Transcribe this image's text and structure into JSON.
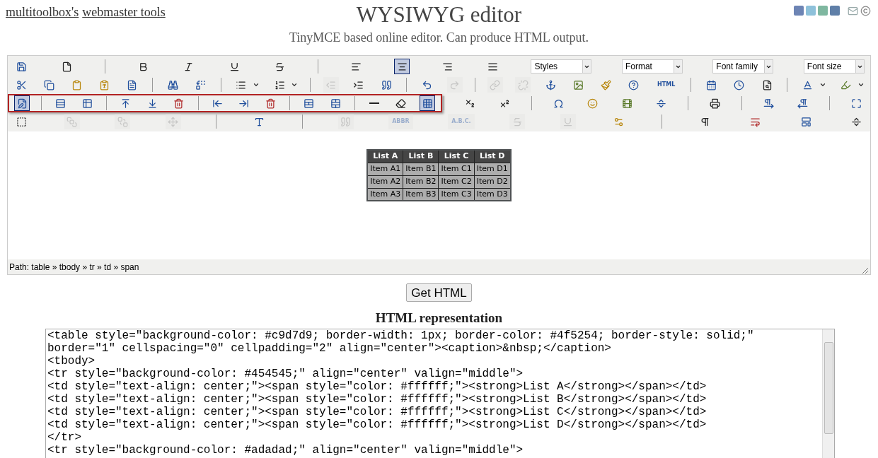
{
  "header": {
    "links": [
      "multitoolbox's",
      "webmaster tools"
    ],
    "title": "WYSIWYG editor",
    "subtitle": "TinyMCE based online editor. Can produce HTML output."
  },
  "toolbar": [
    {
      "groups": [
        {
          "highlighted": false,
          "items": [
            {
              "kind": "button",
              "selected": false,
              "disabled": false
            },
            {
              "kind": "button",
              "selected": false,
              "disabled": false
            },
            {
              "kind": "separator"
            },
            {
              "kind": "button",
              "selected": false,
              "disabled": false
            },
            {
              "kind": "button",
              "selected": false,
              "disabled": false
            },
            {
              "kind": "button",
              "selected": false,
              "disabled": false
            },
            {
              "kind": "button",
              "selected": false,
              "disabled": false
            },
            {
              "kind": "separator"
            },
            {
              "kind": "button",
              "selected": false,
              "disabled": false
            },
            {
              "kind": "button",
              "selected": true,
              "disabled": false
            },
            {
              "kind": "button",
              "selected": false,
              "disabled": false
            },
            {
              "kind": "button",
              "selected": false,
              "disabled": false
            },
            {
              "kind": "select",
              "value": "Styles"
            },
            {
              "kind": "select",
              "value": "Format"
            },
            {
              "kind": "select",
              "value": "Font family"
            },
            {
              "kind": "select",
              "value": "Font size"
            }
          ]
        }
      ]
    },
    {
      "groups": [
        {
          "highlighted": false,
          "items": [
            {
              "kind": "button",
              "selected": false,
              "disabled": false
            },
            {
              "kind": "button",
              "selected": false,
              "disabled": false
            },
            {
              "kind": "button",
              "selected": false,
              "disabled": false
            },
            {
              "kind": "button",
              "selected": false,
              "disabled": false
            },
            {
              "kind": "button",
              "selected": false,
              "disabled": false
            },
            {
              "kind": "separator"
            },
            {
              "kind": "button",
              "selected": false,
              "disabled": false
            },
            {
              "kind": "button",
              "selected": false,
              "disabled": false
            },
            {
              "kind": "separator"
            },
            {
              "kind": "button",
              "selected": false,
              "disabled": false
            },
            {
              "kind": "arrow"
            },
            {
              "kind": "button",
              "selected": false,
              "disabled": false
            },
            {
              "kind": "arrow"
            },
            {
              "kind": "separator"
            },
            {
              "kind": "button",
              "selected": false,
              "disabled": true
            },
            {
              "kind": "button",
              "selected": false,
              "disabled": false
            },
            {
              "kind": "button",
              "selected": false,
              "disabled": false
            },
            {
              "kind": "separator"
            },
            {
              "kind": "button",
              "selected": false,
              "disabled": false
            },
            {
              "kind": "button",
              "selected": false,
              "disabled": true
            },
            {
              "kind": "separator"
            },
            {
              "kind": "button",
              "selected": false,
              "disabled": true
            },
            {
              "kind": "button",
              "selected": false,
              "disabled": true
            },
            {
              "kind": "button",
              "selected": false,
              "disabled": false
            },
            {
              "kind": "button",
              "selected": false,
              "disabled": false
            },
            {
              "kind": "button",
              "selected": false,
              "disabled": false
            },
            {
              "kind": "button",
              "selected": false,
              "disabled": false
            },
            {
              "kind": "text",
              "label": "HTML",
              "selected": false,
              "disabled": false
            },
            {
              "kind": "separator"
            },
            {
              "kind": "button",
              "selected": false,
              "disabled": false
            },
            {
              "kind": "button",
              "selected": false,
              "disabled": false
            },
            {
              "kind": "button",
              "selected": false,
              "disabled": false
            },
            {
              "kind": "separator"
            },
            {
              "kind": "button",
              "selected": false,
              "disabled": false
            },
            {
              "kind": "arrow"
            },
            {
              "kind": "button",
              "selected": false,
              "disabled": false
            },
            {
              "kind": "arrow"
            }
          ]
        }
      ]
    },
    {
      "groups": [
        {
          "highlighted": true,
          "items": [
            {
              "kind": "button",
              "selected": true,
              "disabled": false
            },
            {
              "kind": "separator"
            },
            {
              "kind": "button",
              "selected": false,
              "disabled": false
            },
            {
              "kind": "button",
              "selected": false,
              "disabled": false
            },
            {
              "kind": "separator"
            },
            {
              "kind": "button",
              "selected": false,
              "disabled": false
            },
            {
              "kind": "button",
              "selected": false,
              "disabled": false
            },
            {
              "kind": "button",
              "selected": false,
              "disabled": false
            },
            {
              "kind": "separator"
            },
            {
              "kind": "button",
              "selected": false,
              "disabled": false
            },
            {
              "kind": "button",
              "selected": false,
              "disabled": false
            },
            {
              "kind": "button",
              "selected": false,
              "disabled": false
            },
            {
              "kind": "separator"
            },
            {
              "kind": "button",
              "selected": false,
              "disabled": false
            },
            {
              "kind": "button",
              "selected": false,
              "disabled": false
            },
            {
              "kind": "separator"
            },
            {
              "kind": "button",
              "selected": false,
              "disabled": false
            },
            {
              "kind": "button",
              "selected": false,
              "disabled": false
            },
            {
              "kind": "button",
              "selected": true,
              "disabled": false
            }
          ]
        },
        {
          "highlighted": false,
          "items": [
            {
              "kind": "separator"
            },
            {
              "kind": "button",
              "selected": false,
              "disabled": false
            },
            {
              "kind": "button",
              "selected": false,
              "disabled": false
            },
            {
              "kind": "separator"
            },
            {
              "kind": "button",
              "selected": false,
              "disabled": false
            },
            {
              "kind": "button",
              "selected": false,
              "disabled": false
            },
            {
              "kind": "button",
              "selected": false,
              "disabled": false
            },
            {
              "kind": "button",
              "selected": false,
              "disabled": false
            },
            {
              "kind": "separator"
            },
            {
              "kind": "button",
              "selected": false,
              "disabled": false
            },
            {
              "kind": "separator"
            },
            {
              "kind": "button",
              "selected": false,
              "disabled": false
            },
            {
              "kind": "button",
              "selected": false,
              "disabled": false
            },
            {
              "kind": "separator"
            },
            {
              "kind": "button",
              "selected": false,
              "disabled": false
            }
          ]
        }
      ]
    },
    {
      "groups": [
        {
          "highlighted": false,
          "items": [
            {
              "kind": "button",
              "selected": false,
              "disabled": false
            },
            {
              "kind": "button",
              "selected": false,
              "disabled": true
            },
            {
              "kind": "button",
              "selected": false,
              "disabled": true
            },
            {
              "kind": "button",
              "selected": false,
              "disabled": true
            },
            {
              "kind": "separator"
            },
            {
              "kind": "button",
              "selected": false,
              "disabled": false
            },
            {
              "kind": "separator"
            },
            {
              "kind": "button",
              "selected": false,
              "disabled": true
            },
            {
              "kind": "text",
              "label": "ABBR",
              "selected": false,
              "disabled": true
            },
            {
              "kind": "text",
              "label": "A.B.C.",
              "selected": false,
              "disabled": true
            },
            {
              "kind": "button",
              "selected": false,
              "disabled": true
            },
            {
              "kind": "button",
              "selected": false,
              "disabled": true
            },
            {
              "kind": "button",
              "selected": false,
              "disabled": false
            },
            {
              "kind": "separator"
            },
            {
              "kind": "button",
              "selected": false,
              "disabled": false
            },
            {
              "kind": "button",
              "selected": false,
              "disabled": false
            },
            {
              "kind": "button",
              "selected": false,
              "disabled": false
            },
            {
              "kind": "button",
              "selected": false,
              "disabled": false
            }
          ]
        }
      ]
    }
  ],
  "editor": {
    "table": {
      "columns": [
        "List A",
        "List B",
        "List C",
        "List D"
      ],
      "rows": [
        [
          "Item A1",
          "Item B1",
          "Item C1",
          "Item D1"
        ],
        [
          "Item A2",
          "Item B2",
          "Item C2",
          "Item D2"
        ],
        [
          "Item A3",
          "Item B3",
          "Item C3",
          "Item D3"
        ]
      ]
    },
    "path": "Path: table » tbody » tr » td » span"
  },
  "get_html_button": "Get HTML",
  "html_heading": "HTML representation",
  "html_output": "<table style=\"background-color: #c9d7d9; border-width: 1px; border-color: #4f5254; border-style: solid;\"\nborder=\"1\" cellspacing=\"0\" cellpadding=\"2\" align=\"center\"><caption>&nbsp;</caption>\n<tbody>\n<tr style=\"background-color: #454545;\" align=\"center\" valign=\"middle\">\n<td style=\"text-align: center;\"><span style=\"color: #ffffff;\"><strong>List A</strong></span></td>\n<td style=\"text-align: center;\"><span style=\"color: #ffffff;\"><strong>List B</strong></span></td>\n<td style=\"text-align: center;\"><span style=\"color: #ffffff;\"><strong>List C</strong></span></td>\n<td style=\"text-align: center;\"><span style=\"color: #ffffff;\"><strong>List D</strong></span></td>\n</tr>\n<tr style=\"background-color: #adadad;\" align=\"center\" valign=\"middle\">"
}
